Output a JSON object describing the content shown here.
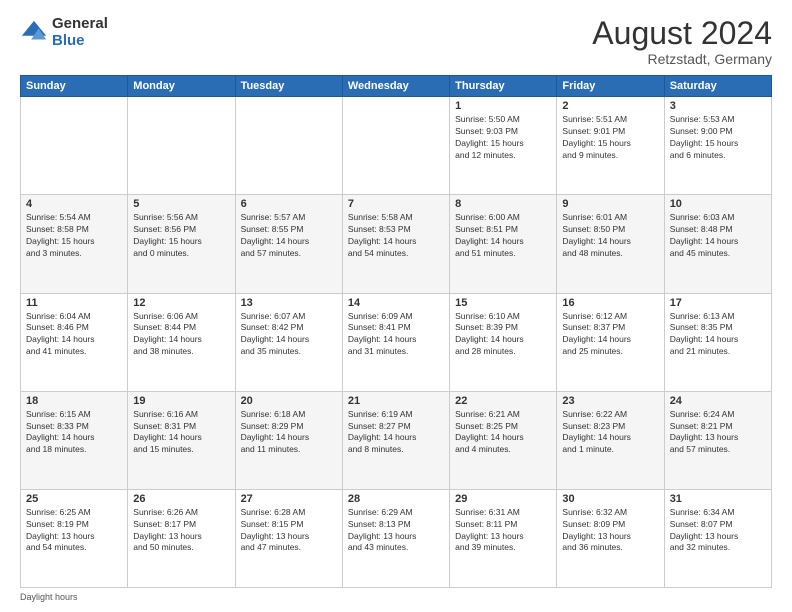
{
  "header": {
    "logo_general": "General",
    "logo_blue": "Blue",
    "month_year": "August 2024",
    "location": "Retzstadt, Germany"
  },
  "footer": {
    "note": "Daylight hours"
  },
  "days_of_week": [
    "Sunday",
    "Monday",
    "Tuesday",
    "Wednesday",
    "Thursday",
    "Friday",
    "Saturday"
  ],
  "weeks": [
    [
      {
        "day": "",
        "info": ""
      },
      {
        "day": "",
        "info": ""
      },
      {
        "day": "",
        "info": ""
      },
      {
        "day": "",
        "info": ""
      },
      {
        "day": "1",
        "info": "Sunrise: 5:50 AM\nSunset: 9:03 PM\nDaylight: 15 hours\nand 12 minutes."
      },
      {
        "day": "2",
        "info": "Sunrise: 5:51 AM\nSunset: 9:01 PM\nDaylight: 15 hours\nand 9 minutes."
      },
      {
        "day": "3",
        "info": "Sunrise: 5:53 AM\nSunset: 9:00 PM\nDaylight: 15 hours\nand 6 minutes."
      }
    ],
    [
      {
        "day": "4",
        "info": "Sunrise: 5:54 AM\nSunset: 8:58 PM\nDaylight: 15 hours\nand 3 minutes."
      },
      {
        "day": "5",
        "info": "Sunrise: 5:56 AM\nSunset: 8:56 PM\nDaylight: 15 hours\nand 0 minutes."
      },
      {
        "day": "6",
        "info": "Sunrise: 5:57 AM\nSunset: 8:55 PM\nDaylight: 14 hours\nand 57 minutes."
      },
      {
        "day": "7",
        "info": "Sunrise: 5:58 AM\nSunset: 8:53 PM\nDaylight: 14 hours\nand 54 minutes."
      },
      {
        "day": "8",
        "info": "Sunrise: 6:00 AM\nSunset: 8:51 PM\nDaylight: 14 hours\nand 51 minutes."
      },
      {
        "day": "9",
        "info": "Sunrise: 6:01 AM\nSunset: 8:50 PM\nDaylight: 14 hours\nand 48 minutes."
      },
      {
        "day": "10",
        "info": "Sunrise: 6:03 AM\nSunset: 8:48 PM\nDaylight: 14 hours\nand 45 minutes."
      }
    ],
    [
      {
        "day": "11",
        "info": "Sunrise: 6:04 AM\nSunset: 8:46 PM\nDaylight: 14 hours\nand 41 minutes."
      },
      {
        "day": "12",
        "info": "Sunrise: 6:06 AM\nSunset: 8:44 PM\nDaylight: 14 hours\nand 38 minutes."
      },
      {
        "day": "13",
        "info": "Sunrise: 6:07 AM\nSunset: 8:42 PM\nDaylight: 14 hours\nand 35 minutes."
      },
      {
        "day": "14",
        "info": "Sunrise: 6:09 AM\nSunset: 8:41 PM\nDaylight: 14 hours\nand 31 minutes."
      },
      {
        "day": "15",
        "info": "Sunrise: 6:10 AM\nSunset: 8:39 PM\nDaylight: 14 hours\nand 28 minutes."
      },
      {
        "day": "16",
        "info": "Sunrise: 6:12 AM\nSunset: 8:37 PM\nDaylight: 14 hours\nand 25 minutes."
      },
      {
        "day": "17",
        "info": "Sunrise: 6:13 AM\nSunset: 8:35 PM\nDaylight: 14 hours\nand 21 minutes."
      }
    ],
    [
      {
        "day": "18",
        "info": "Sunrise: 6:15 AM\nSunset: 8:33 PM\nDaylight: 14 hours\nand 18 minutes."
      },
      {
        "day": "19",
        "info": "Sunrise: 6:16 AM\nSunset: 8:31 PM\nDaylight: 14 hours\nand 15 minutes."
      },
      {
        "day": "20",
        "info": "Sunrise: 6:18 AM\nSunset: 8:29 PM\nDaylight: 14 hours\nand 11 minutes."
      },
      {
        "day": "21",
        "info": "Sunrise: 6:19 AM\nSunset: 8:27 PM\nDaylight: 14 hours\nand 8 minutes."
      },
      {
        "day": "22",
        "info": "Sunrise: 6:21 AM\nSunset: 8:25 PM\nDaylight: 14 hours\nand 4 minutes."
      },
      {
        "day": "23",
        "info": "Sunrise: 6:22 AM\nSunset: 8:23 PM\nDaylight: 14 hours\nand 1 minute."
      },
      {
        "day": "24",
        "info": "Sunrise: 6:24 AM\nSunset: 8:21 PM\nDaylight: 13 hours\nand 57 minutes."
      }
    ],
    [
      {
        "day": "25",
        "info": "Sunrise: 6:25 AM\nSunset: 8:19 PM\nDaylight: 13 hours\nand 54 minutes."
      },
      {
        "day": "26",
        "info": "Sunrise: 6:26 AM\nSunset: 8:17 PM\nDaylight: 13 hours\nand 50 minutes."
      },
      {
        "day": "27",
        "info": "Sunrise: 6:28 AM\nSunset: 8:15 PM\nDaylight: 13 hours\nand 47 minutes."
      },
      {
        "day": "28",
        "info": "Sunrise: 6:29 AM\nSunset: 8:13 PM\nDaylight: 13 hours\nand 43 minutes."
      },
      {
        "day": "29",
        "info": "Sunrise: 6:31 AM\nSunset: 8:11 PM\nDaylight: 13 hours\nand 39 minutes."
      },
      {
        "day": "30",
        "info": "Sunrise: 6:32 AM\nSunset: 8:09 PM\nDaylight: 13 hours\nand 36 minutes."
      },
      {
        "day": "31",
        "info": "Sunrise: 6:34 AM\nSunset: 8:07 PM\nDaylight: 13 hours\nand 32 minutes."
      }
    ]
  ]
}
